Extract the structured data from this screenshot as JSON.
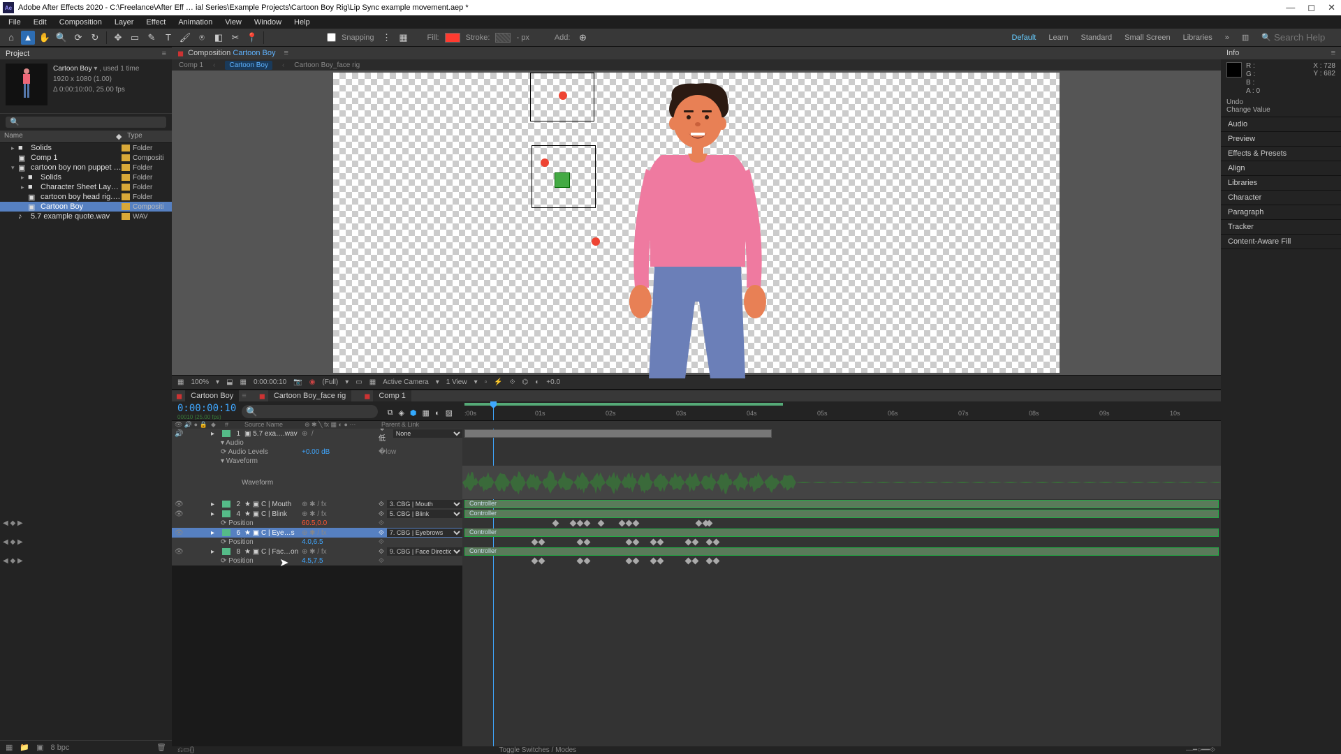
{
  "title": "Adobe After Effects 2020 - C:\\Freelance\\After Eff … ial Series\\Example Projects\\Cartoon Boy Rig\\Lip Sync example movement.aep *",
  "menu": [
    "File",
    "Edit",
    "Composition",
    "Layer",
    "Effect",
    "Animation",
    "View",
    "Window",
    "Help"
  ],
  "toolbar": {
    "snapping": "Snapping",
    "fill": "Fill:",
    "stroke": "Stroke:",
    "stroke_px": "px",
    "add": "Add:"
  },
  "workspaces": [
    "Default",
    "Learn",
    "Standard",
    "Small Screen",
    "Libraries"
  ],
  "search_placeholder": "Search Help",
  "project": {
    "panel": "Project",
    "selected_name": "Cartoon Boy",
    "selected_used": "▾ , used 1 time",
    "meta1": "1920 x 1080 (1.00)",
    "meta2": "Δ 0:00:10:00, 25.00 fps",
    "col_name": "Name",
    "col_type": "Type",
    "tree": [
      {
        "d": 0,
        "tw": "▸",
        "ico": "■",
        "nm": "Solids",
        "type": "Folder"
      },
      {
        "d": 0,
        "tw": "",
        "ico": "▣",
        "nm": "Comp 1",
        "type": "Compositi"
      },
      {
        "d": 0,
        "tw": "▾",
        "ico": "▣",
        "nm": "cartoon boy non puppet pin.aep",
        "type": "Folder"
      },
      {
        "d": 1,
        "tw": "▸",
        "ico": "■",
        "nm": "Solids",
        "type": "Folder"
      },
      {
        "d": 1,
        "tw": "▸",
        "ico": "■",
        "nm": "Character Sheet Layers",
        "type": "Folder"
      },
      {
        "d": 1,
        "tw": "",
        "ico": "▣",
        "nm": "cartoon boy head rig.aep",
        "type": "Folder"
      },
      {
        "d": 1,
        "tw": "",
        "ico": "▣",
        "nm": "Cartoon Boy",
        "type": "Compositi",
        "sel": true
      },
      {
        "d": 0,
        "tw": "",
        "ico": "♪",
        "nm": "5.7 example quote.wav",
        "type": "WAV"
      }
    ],
    "bpc": "8 bpc"
  },
  "comp": {
    "panel_prefix": "Composition",
    "panel_name": "Cartoon Boy",
    "crumbs": [
      "Comp 1",
      "Cartoon Boy",
      "Cartoon Boy_face rig"
    ],
    "footer": {
      "zoom": "100%",
      "res_menu": "(Full)",
      "tc": "0:00:00:10",
      "cam": "Active Camera",
      "views": "1 View",
      "exposure": "+0.0"
    }
  },
  "info": {
    "panel": "Info",
    "r": "R :",
    "g": "G :",
    "b": "B :",
    "a": "A : 0",
    "x": "X : 728",
    "y": "Y : 682",
    "undo": "Undo",
    "change": "Change Value"
  },
  "right_panels": [
    "Audio",
    "Preview",
    "Effects & Presets",
    "Align",
    "Libraries",
    "Character",
    "Paragraph",
    "Tracker",
    "Content-Aware Fill"
  ],
  "timeline": {
    "tabs": [
      "Cartoon Boy",
      "Cartoon Boy_face rig",
      "Comp 1"
    ],
    "timecode": "0:00:00:10",
    "subtc": "00010 (25.00 fps)",
    "ruler": [
      ":00s",
      "01s",
      "02s",
      "03s",
      "04s",
      "05s",
      "06s",
      "07s",
      "08s",
      "09s",
      "10s"
    ],
    "col_src": "Source Name",
    "col_parent": "Parent & Link",
    "layers": [
      {
        "num": "1",
        "color": "#55bb88",
        "name": "5.7 exa….wav",
        "parent": "None"
      },
      {
        "num": "2",
        "color": "#55bb88",
        "name": "★ ▣ C | Mouth",
        "parent": "3. CBG | Mouth",
        "ctrl": true
      },
      {
        "num": "4",
        "color": "#55bb88",
        "name": "★ ▣ C | Blink",
        "parent": "5. CBG | Blink",
        "ctrl": true
      },
      {
        "num": "6",
        "color": "#55bb88",
        "name": "★ ▣ C | Eye…s",
        "parent": "7. CBG | Eyebrows",
        "ctrl": true,
        "sel": true
      },
      {
        "num": "8",
        "color": "#55bb88",
        "name": "★ ▣ C | Fac…on",
        "parent": "9. CBG | Face Direction",
        "ctrl": true
      }
    ],
    "audio_label": "Audio",
    "audio_levels": "Audio Levels",
    "audio_val": "+0.00 dB",
    "waveform": "Waveform",
    "position": "Position",
    "pos_vals": [
      "60.5,0.0",
      "4.0,6.5",
      "4.5,7.5"
    ],
    "footer": "Toggle Switches / Modes"
  }
}
